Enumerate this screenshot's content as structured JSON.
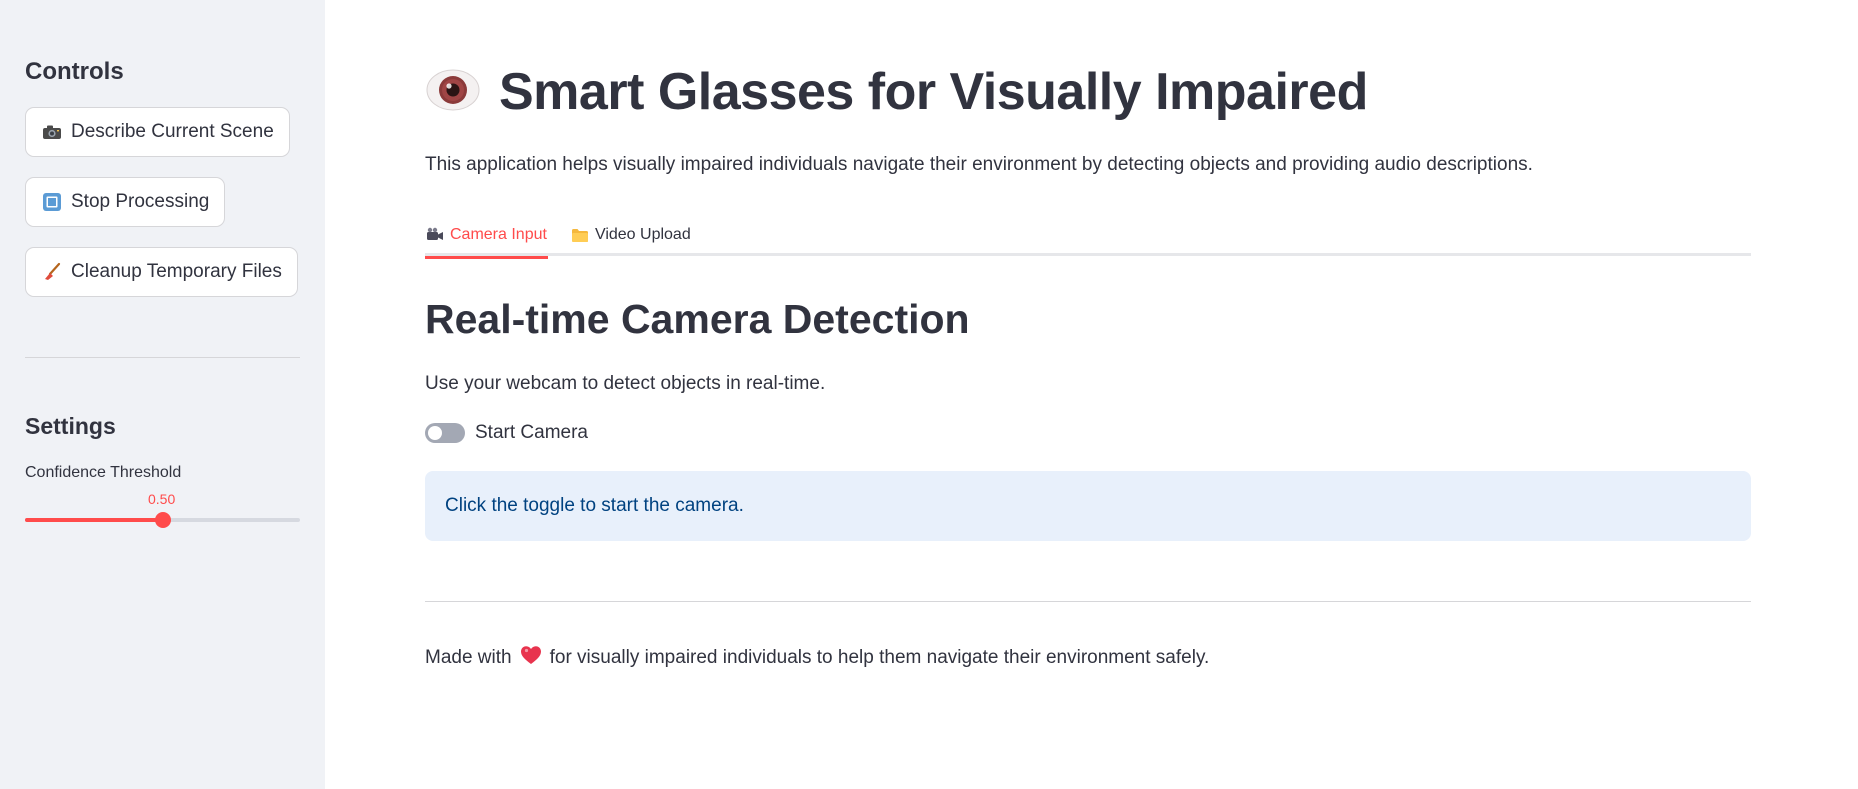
{
  "sidebar": {
    "controls_heading": "Controls",
    "buttons": [
      {
        "label": "Describe Current Scene",
        "icon": "camera-icon"
      },
      {
        "label": "Stop Processing",
        "icon": "stop-square-icon"
      },
      {
        "label": "Cleanup Temporary Files",
        "icon": "broom-icon"
      }
    ],
    "settings_heading": "Settings",
    "slider": {
      "label": "Confidence Threshold",
      "value": "0.50",
      "fraction": 0.5
    }
  },
  "main": {
    "title_icon": "eye-icon",
    "title": "Smart Glasses for Visually Impaired",
    "description": "This application helps visually impaired individuals navigate their environment by detecting objects and providing audio descriptions.",
    "tabs": [
      {
        "label": "Camera Input",
        "icon": "video-camera-icon",
        "active": true
      },
      {
        "label": "Video Upload",
        "icon": "folder-icon",
        "active": false
      }
    ],
    "section_title": "Real-time Camera Detection",
    "section_sub": "Use your webcam to detect objects in real-time.",
    "toggle": {
      "label": "Start Camera",
      "on": false
    },
    "info_message": "Click the toggle to start the camera.",
    "footer": {
      "prefix": "Made with",
      "icon": "heart-icon",
      "suffix": "for visually impaired individuals to help them navigate their environment safely."
    }
  },
  "colors": {
    "accent": "#ff4b4b",
    "sidebar_bg": "#f0f2f6",
    "info_bg": "#e8f0fb",
    "info_text": "#004280",
    "text": "#31333f"
  }
}
